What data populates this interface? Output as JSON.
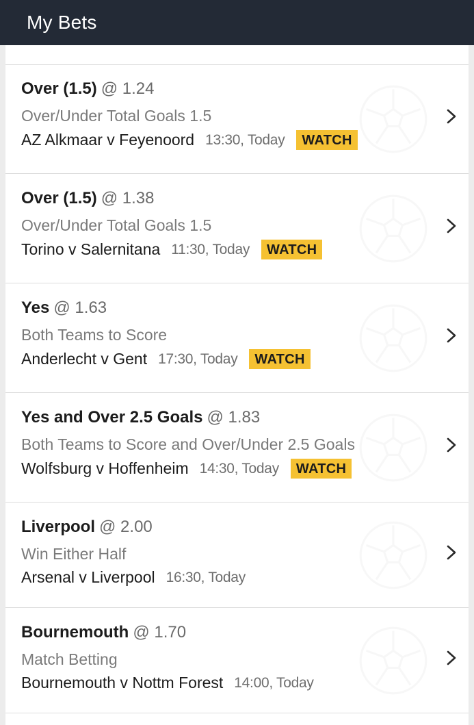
{
  "header": {
    "title": "My Bets"
  },
  "bets": [
    {
      "selection": "Over (1.5)",
      "odds": "@ 1.24",
      "market": "Over/Under Total Goals 1.5",
      "event": "AZ Alkmaar v Feyenoord",
      "time": "13:30, Today",
      "watch": "WATCH",
      "icons": [
        "football-icon",
        "chevron-right-icon"
      ]
    },
    {
      "selection": "Over (1.5)",
      "odds": "@ 1.38",
      "market": "Over/Under Total Goals 1.5",
      "event": "Torino v Salernitana",
      "time": "11:30, Today",
      "watch": "WATCH",
      "icons": [
        "football-icon",
        "chevron-right-icon"
      ]
    },
    {
      "selection": "Yes",
      "odds": "@ 1.63",
      "market": "Both Teams to Score",
      "event": "Anderlecht v Gent",
      "time": "17:30, Today",
      "watch": "WATCH",
      "icons": [
        "football-icon",
        "chevron-right-icon"
      ]
    },
    {
      "selection": "Yes and Over 2.5 Goals",
      "odds": "@ 1.83",
      "market": "Both Teams to Score and Over/Under 2.5 Goals",
      "event": "Wolfsburg v Hoffenheim",
      "time": "14:30, Today",
      "watch": "WATCH",
      "icons": [
        "football-icon",
        "chevron-right-icon"
      ]
    },
    {
      "selection": "Liverpool",
      "odds": "@ 2.00",
      "market": "Win Either Half",
      "event": "Arsenal v Liverpool",
      "time": "16:30, Today",
      "watch": null,
      "icons": [
        "football-icon",
        "chevron-right-icon"
      ]
    },
    {
      "selection": "Bournemouth",
      "odds": "@ 1.70",
      "market": "Match Betting",
      "event": "Bournemouth v Nottm Forest",
      "time": "14:00, Today",
      "watch": null,
      "icons": [
        "football-icon",
        "chevron-right-icon"
      ]
    }
  ],
  "colors": {
    "header_bg": "#232a36",
    "watch_badge": "#f5c132",
    "background": "#ececec"
  }
}
